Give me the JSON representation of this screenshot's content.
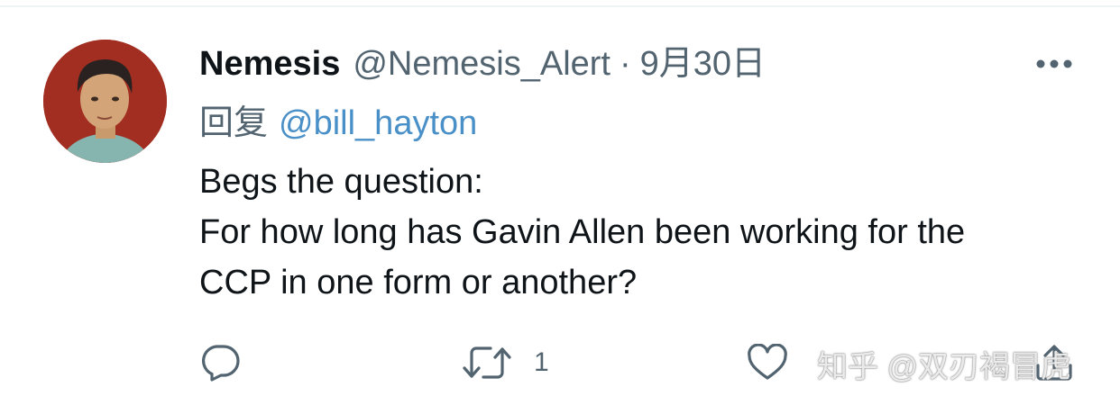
{
  "tweet": {
    "display_name": "Nemesis",
    "handle": "@Nemesis_Alert",
    "separator": "·",
    "date": "9月30日",
    "reply_prefix": "回复",
    "reply_to": "@bill_hayton",
    "text_lines": [
      "Begs the question:",
      "For how long has Gavin Allen been working for the",
      "CCP in one form or another?"
    ]
  },
  "actions": {
    "reply_count": "",
    "retweet_count": "1",
    "like_count": "",
    "icon_reply": "reply-bubble-icon",
    "icon_retweet": "retweet-icon",
    "icon_like": "heart-icon",
    "icon_share": "share-icon",
    "icon_more": "more-dots-icon"
  },
  "watermark": {
    "text": "知乎 @双刃褐冒虎"
  },
  "colors": {
    "primary_text": "#0f1419",
    "secondary_text": "#536471",
    "mention_blue": "#4a90c8",
    "avatar_background": "#9b2a1e"
  }
}
